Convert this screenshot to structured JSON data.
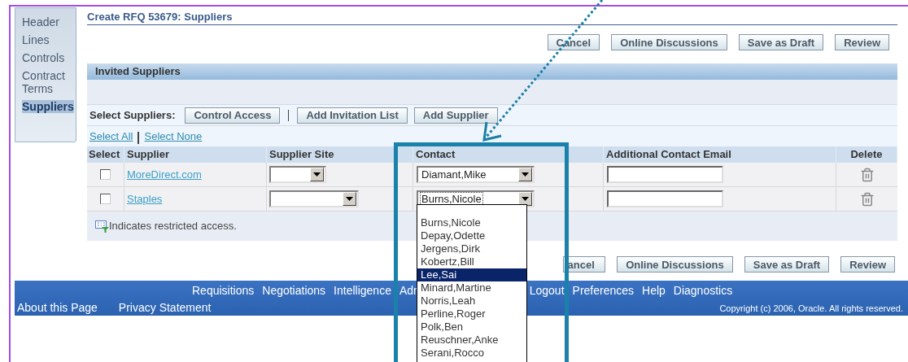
{
  "sidebar": {
    "items": [
      {
        "label": "Header",
        "selected": false
      },
      {
        "label": "Lines",
        "selected": false
      },
      {
        "label": "Controls",
        "selected": false
      },
      {
        "label": "Contract Terms",
        "selected": false
      },
      {
        "label": "Suppliers",
        "selected": true
      }
    ]
  },
  "page_title": "Create RFQ 53679: Suppliers",
  "top_buttons": [
    "Cancel",
    "Online Discussions",
    "Save as Draft",
    "Review"
  ],
  "section": {
    "title": "Invited Suppliers",
    "select_label": "Select Suppliers:",
    "actions": [
      "Control Access",
      "Add Invitation List",
      "Add Supplier"
    ],
    "select_all": "Select All",
    "select_none": "Select None",
    "table": {
      "columns": [
        "Select",
        "Supplier",
        "Supplier Site",
        "Contact",
        "Additional Contact Email",
        "Delete"
      ],
      "rows": [
        {
          "checked": false,
          "supplier": "MoreDirect.com",
          "contact": "Diamant,Mike",
          "focused": false
        },
        {
          "checked": false,
          "supplier": "Staples",
          "contact": "Burns,Nicole",
          "focused": true
        }
      ]
    },
    "note": "Indicates restricted access."
  },
  "contact_dropdown": {
    "options": [
      {
        "label": "Burns,Nicole",
        "selected": false
      },
      {
        "label": "Depay,Odette",
        "selected": false
      },
      {
        "label": "Jergens,Dirk",
        "selected": false
      },
      {
        "label": "Kobertz,Bill",
        "selected": false
      },
      {
        "label": "Lee,Sai",
        "selected": true
      },
      {
        "label": "Minard,Martine",
        "selected": false
      },
      {
        "label": "Norris,Leah",
        "selected": false
      },
      {
        "label": "Perline,Roger",
        "selected": false
      },
      {
        "label": "Polk,Ben",
        "selected": false
      },
      {
        "label": "Reuschner,Anke",
        "selected": false
      },
      {
        "label": "Serani,Rocco",
        "selected": false
      }
    ]
  },
  "bottom_buttons": [
    "ancel",
    "Online Discussions",
    "Save as Draft",
    "Review"
  ],
  "footer": {
    "links": [
      "Requisitions",
      "Negotiations",
      "Intelligence",
      "Adr",
      "Logout",
      "Preferences",
      "Help",
      "Diagnostics"
    ],
    "bottom_links": [
      "About this Page",
      "Privacy Statement"
    ],
    "copyright": "Copyright (c) 2006, Oracle. All rights reserved."
  }
}
